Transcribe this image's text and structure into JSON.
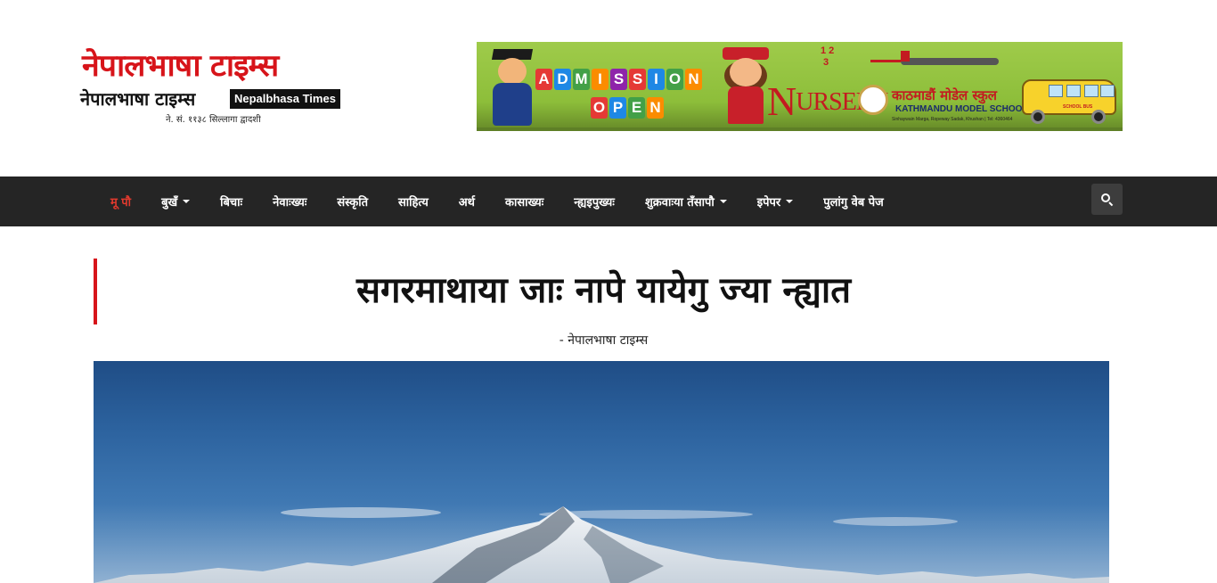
{
  "logo": {
    "script_text": "नेपालभाषा टाइम्स",
    "devanagari": "नेपालभाषा टाइम्स",
    "english": "Nepalbhasa Times",
    "date": "ने. सं. ११३८ सिल्लागा द्वादशी"
  },
  "ad": {
    "admission_letters": [
      "A",
      "D",
      "M",
      "I",
      "S",
      "S",
      "I",
      "O",
      "N"
    ],
    "open_letters": [
      "O",
      "P",
      "E",
      "N"
    ],
    "nursery_first": "N",
    "nursery_rest": "URSERY",
    "school_name_np": "काठमाडौं मोडेल स्कुल",
    "school_name_en": "KATHMANDU MODEL SCHOOL",
    "school_address": "Sinhaywain Marga, Ropeway Sadak, Khushan | Tel: 4360464",
    "bus_label": "SCHOOL BUS",
    "numbers": "1 2\n 3",
    "tile_colors": [
      "#e53935",
      "#1e88e5",
      "#43a047",
      "#fb8c00",
      "#8e24aa",
      "#e53935",
      "#1e88e5",
      "#43a047",
      "#fb8c00"
    ],
    "open_tile_colors": [
      "#e53935",
      "#1e88e5",
      "#43a047",
      "#fb8c00"
    ]
  },
  "nav": {
    "items": [
      {
        "label": "मू पौ",
        "active": true,
        "dropdown": false
      },
      {
        "label": "बुखँ",
        "active": false,
        "dropdown": true
      },
      {
        "label": "बिचाः",
        "active": false,
        "dropdown": false
      },
      {
        "label": "नेवाःख्यः",
        "active": false,
        "dropdown": false
      },
      {
        "label": "संस्कृति",
        "active": false,
        "dropdown": false
      },
      {
        "label": "साहित्य",
        "active": false,
        "dropdown": false
      },
      {
        "label": "अर्थ",
        "active": false,
        "dropdown": false
      },
      {
        "label": "कासाख्यः",
        "active": false,
        "dropdown": false
      },
      {
        "label": "न्ह्यइपुख्यः",
        "active": false,
        "dropdown": false
      },
      {
        "label": "शुक्रवाःया तँसापौ",
        "active": false,
        "dropdown": true
      },
      {
        "label": "इपेपर",
        "active": false,
        "dropdown": true
      },
      {
        "label": "पुलांगु वेब पेज",
        "active": false,
        "dropdown": false
      }
    ],
    "search_icon": "search-icon",
    "background": "#252525",
    "active_color": "#e23a2e"
  },
  "article": {
    "title": "सगरमाथाया जाः नापे यायेगु ज्या न्ह्यात",
    "byline": "- नेपालभाषा टाइम्स",
    "accent_color": "#d7141a"
  }
}
